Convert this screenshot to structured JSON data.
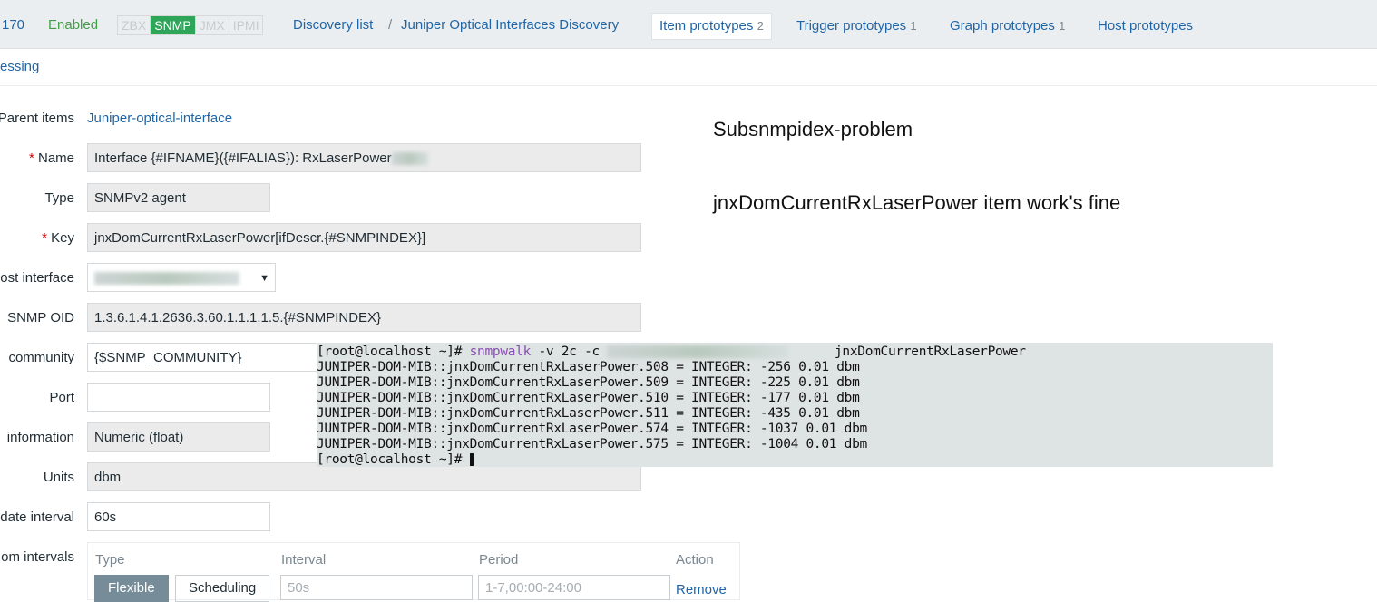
{
  "header": {
    "host_id_fragment": "170",
    "status": "Enabled",
    "tags": [
      "ZBX",
      "SNMP",
      "JMX",
      "IPMI"
    ],
    "active_tag": "SNMP",
    "breadcrumb": [
      "Discovery list",
      "Juniper Optical Interfaces Discovery"
    ],
    "separator": "/",
    "tabs": [
      {
        "label": "Item prototypes",
        "count": "2"
      },
      {
        "label": "Trigger prototypes",
        "count": "1"
      },
      {
        "label": "Graph prototypes",
        "count": "1"
      },
      {
        "label": "Host prototypes",
        "count": ""
      }
    ]
  },
  "subtab": "essing",
  "form": {
    "parent_items": {
      "label": "Parent items",
      "value": "Juniper-optical-interface"
    },
    "name": {
      "label": "Name",
      "value": "Interface {#IFNAME}({#IFALIAS}): RxLaserPower"
    },
    "type": {
      "label": "Type",
      "value": "SNMPv2 agent"
    },
    "key": {
      "label": "Key",
      "value": "jnxDomCurrentRxLaserPower[ifDescr.{#SNMPINDEX}]"
    },
    "host_interface": {
      "label": "ost interface",
      "value": ""
    },
    "snmp_oid": {
      "label": "SNMP OID",
      "value": "1.3.6.1.4.1.2636.3.60.1.1.1.1.5.{#SNMPINDEX}"
    },
    "community": {
      "label": "community",
      "value": "{$SNMP_COMMUNITY}"
    },
    "port": {
      "label": "Port",
      "value": ""
    },
    "type_info": {
      "label": "information",
      "value": "Numeric (float)"
    },
    "units": {
      "label": "Units",
      "value": "dbm"
    },
    "update_interval": {
      "label": "date interval",
      "value": "60s"
    },
    "custom_intervals": {
      "label": "om intervals",
      "headers": [
        "Type",
        "Interval",
        "Period",
        "Action"
      ],
      "type_options": [
        "Flexible",
        "Scheduling"
      ],
      "interval_placeholder": "50s",
      "period_placeholder": "1-7,00:00-24:00",
      "remove": "Remove"
    }
  },
  "notes": [
    "Subsnmpidex-problem",
    "jnxDomCurrentRxLaserPower item work's fine"
  ],
  "terminal": {
    "prompt": "[root@localhost ~]# ",
    "command": "snmpwalk",
    "args": " -v 2c -c ",
    "oid": "jnxDomCurrentRxLaserPower",
    "lines": [
      "JUNIPER-DOM-MIB::jnxDomCurrentRxLaserPower.508 = INTEGER: -256 0.01 dbm",
      "JUNIPER-DOM-MIB::jnxDomCurrentRxLaserPower.509 = INTEGER: -225 0.01 dbm",
      "JUNIPER-DOM-MIB::jnxDomCurrentRxLaserPower.510 = INTEGER: -177 0.01 dbm",
      "JUNIPER-DOM-MIB::jnxDomCurrentRxLaserPower.511 = INTEGER: -435 0.01 dbm",
      "JUNIPER-DOM-MIB::jnxDomCurrentRxLaserPower.574 = INTEGER: -1037 0.01 dbm",
      "JUNIPER-DOM-MIB::jnxDomCurrentRxLaserPower.575 = INTEGER: -1004 0.01 dbm"
    ],
    "final_prompt": "[root@localhost ~]# "
  }
}
